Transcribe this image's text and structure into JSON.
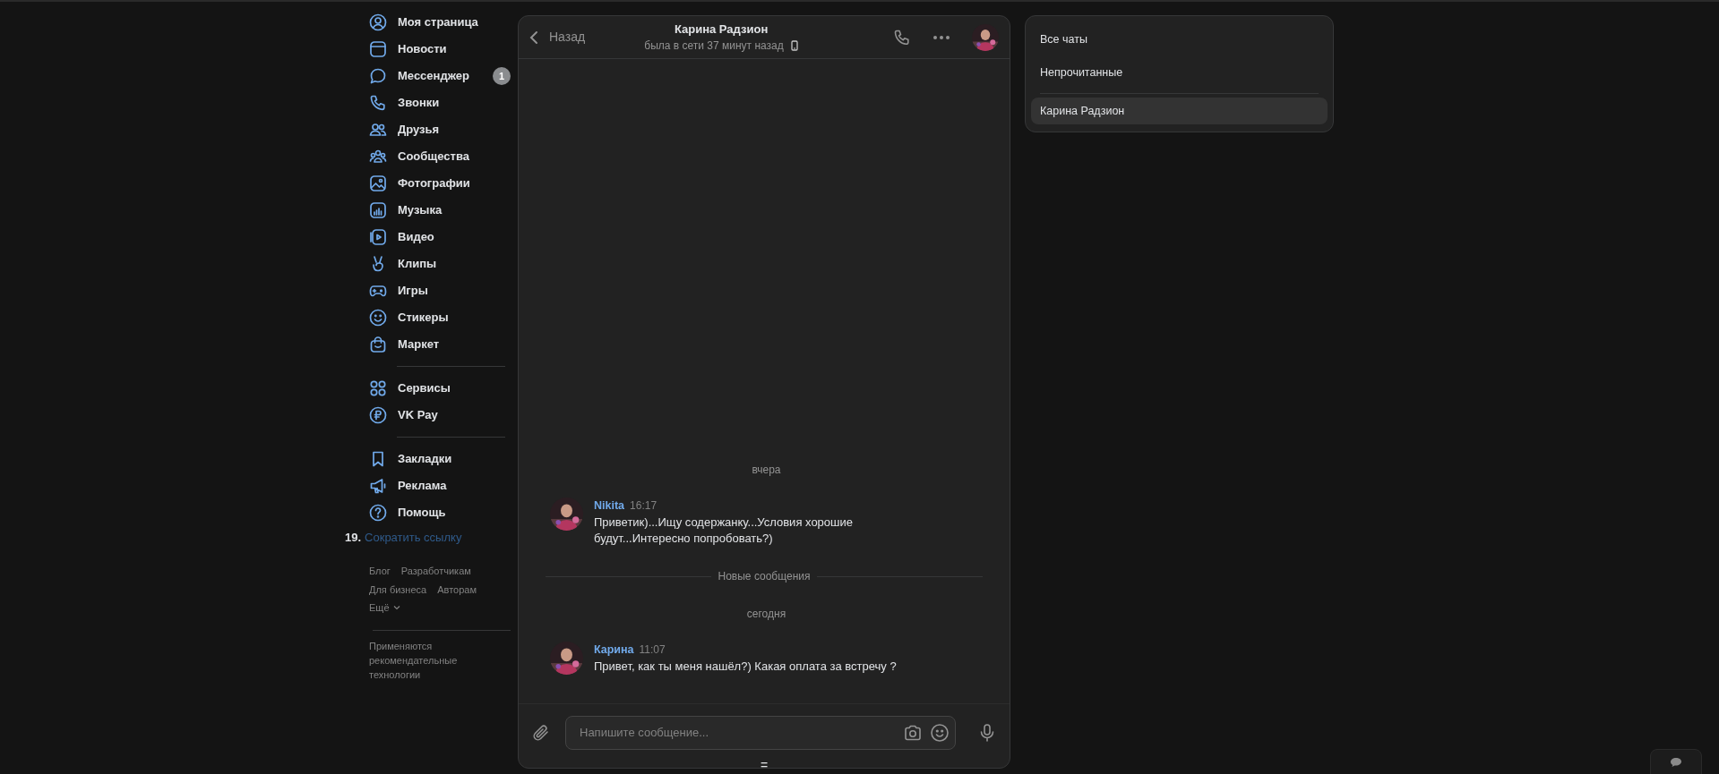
{
  "sidebar": {
    "groups": [
      {
        "items": [
          {
            "label": "Моя страница"
          },
          {
            "label": "Новости"
          },
          {
            "label": "Мессенджер",
            "badge": "1"
          },
          {
            "label": "Звонки"
          },
          {
            "label": "Друзья"
          },
          {
            "label": "Сообщества"
          },
          {
            "label": "Фотографии"
          },
          {
            "label": "Музыка"
          },
          {
            "label": "Видео"
          },
          {
            "label": "Клипы"
          },
          {
            "label": "Игры"
          },
          {
            "label": "Стикеры"
          },
          {
            "label": "Маркет"
          }
        ]
      },
      {
        "items": [
          {
            "label": "Сервисы"
          },
          {
            "label": "VK Pay"
          }
        ]
      },
      {
        "items": [
          {
            "label": "Закладки"
          },
          {
            "label": "Реклама"
          },
          {
            "label": "Помощь"
          }
        ]
      }
    ]
  },
  "short_link": {
    "number": "19.",
    "label": "Сократить ссылку"
  },
  "footer_links": [
    "Блог",
    "Разработчикам",
    "Для бизнеса",
    "Авторам"
  ],
  "more": "Ещё",
  "footer_note": "Применяются рекомендательные технологии",
  "chat": {
    "back": "Назад",
    "title": "Карина Радзион",
    "status": "была в сети 37 минут назад",
    "timeline": [
      {
        "kind": "date",
        "text": "вчера"
      },
      {
        "kind": "message",
        "author": "Nikita",
        "time": "16:17",
        "text": "Приветик)...Ищу содержанку...Условия хорошие будут...Интересно попробовать?)"
      },
      {
        "kind": "separator",
        "text": "Новые сообщения"
      },
      {
        "kind": "date",
        "text": "сегодня"
      },
      {
        "kind": "message",
        "author": "Карина",
        "time": "11:07",
        "text": "Привет, как ты меня нашёл?) Какая оплата за встречу ?"
      }
    ],
    "input": {
      "placeholder": "Напишите сообщение..."
    },
    "resize_handle": "="
  },
  "folders": [
    {
      "kind": "folder",
      "label": "Все чаты",
      "selected": false
    },
    {
      "kind": "folder",
      "label": "Непрочитанные",
      "selected": false
    },
    {
      "kind": "chat",
      "label": "Карина Радзион",
      "selected": true
    }
  ]
}
